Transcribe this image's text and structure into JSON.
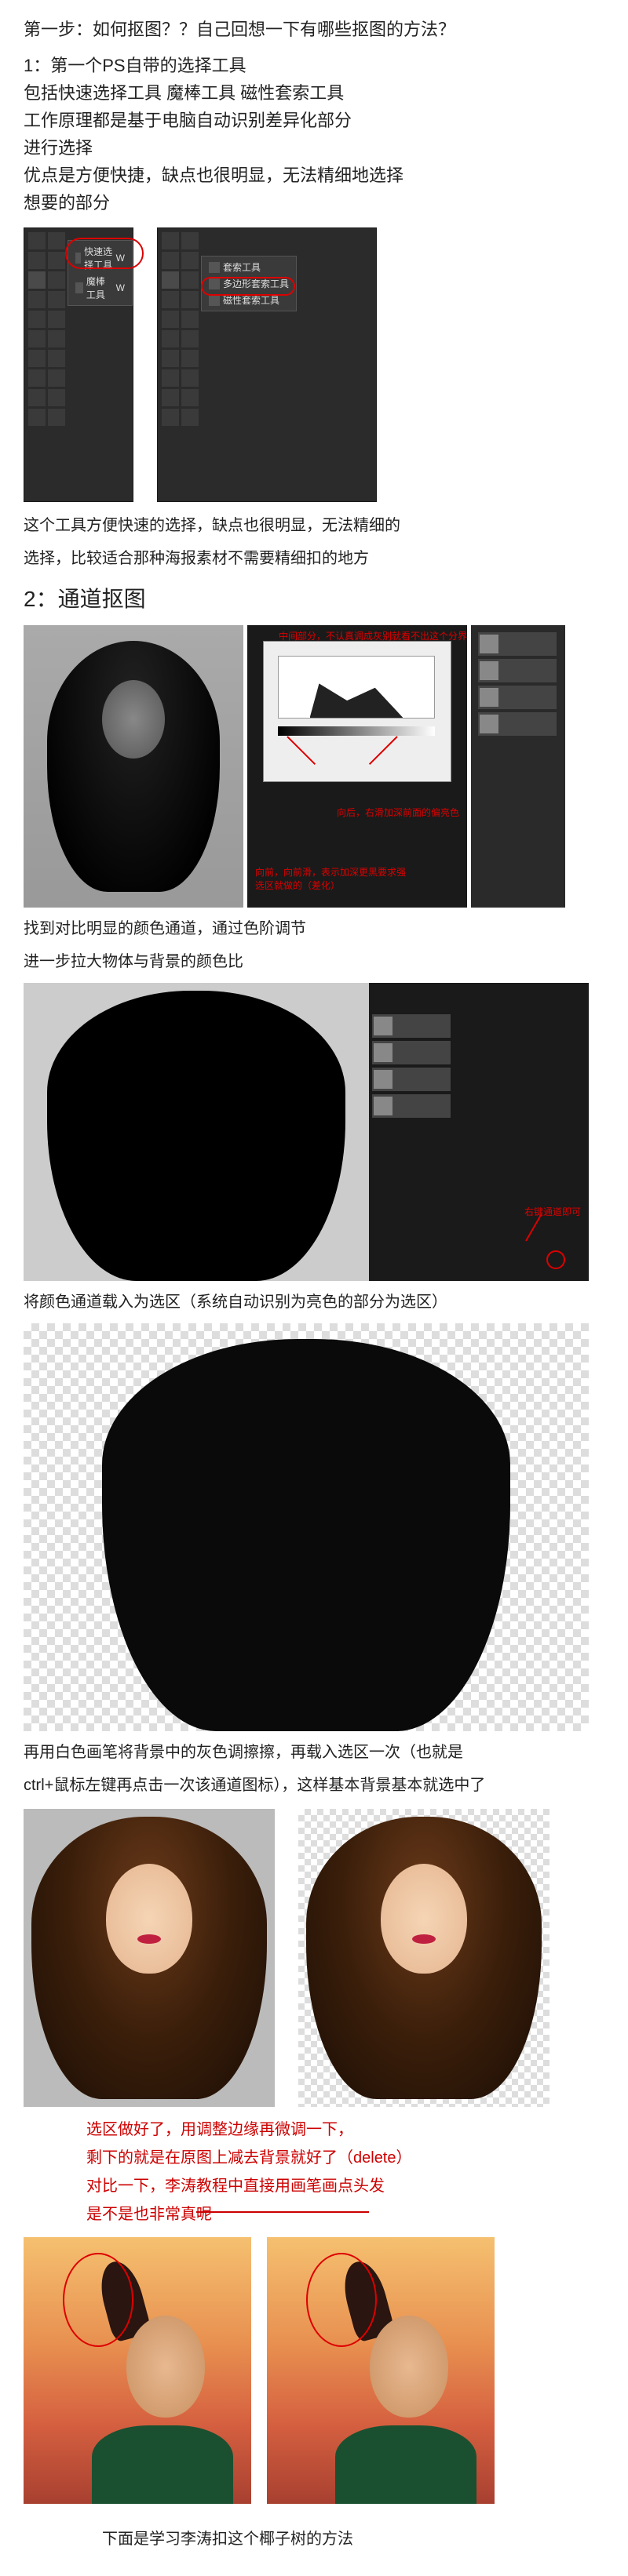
{
  "intro": {
    "step1_title": "第一步：如何抠图？？自己回想一下有哪些抠图的方法？",
    "method1_title": "1：第一个PS自带的选择工具",
    "method1_line1": "包括快速选择工具 魔棒工具 磁性套索工具",
    "method1_line2": "工作原理都是基于电脑自动识别差异化部分",
    "method1_line3": "进行选择",
    "method1_line4": "优点是方便快捷，缺点也很明显，无法精细地选择",
    "method1_line5": "想要的部分"
  },
  "toolbar1_flyout": {
    "item1": "快速选择工具",
    "item1_key": "W",
    "item2": "魔棒工具",
    "item2_key": "W"
  },
  "toolbar2_flyout": {
    "item1": "套索工具",
    "item2": "多边形套索工具",
    "item3": "磁性套索工具"
  },
  "summary1": {
    "line1": "这个工具方便快速的选择，缺点也很明显，无法精细的",
    "line2": "选择，比较适合那种海报素材不需要精细扣的地方"
  },
  "section2_title": "2：通道抠图",
  "levels_annotations": {
    "top_text": "中间部分，不认真调成灰别就看不出这个分界点",
    "bottom_right": "向后，右滑加深前面的偏亮色",
    "bottom_left": "向前，向前滑，表示加深更黑要求强选区就做的（差化）"
  },
  "caption1": {
    "line1": "找到对比明显的颜色通道，通过色阶调节",
    "line2": "进一步拉大物体与背景的颜色比"
  },
  "channel_annotation": "右键通道即可",
  "caption2": "将颜色通道载入为选区（系统自动识别为亮色的部分为选区）",
  "caption3": {
    "line1": "再用白色画笔将背景中的灰色调擦擦，再载入选区一次（也就是",
    "line2": "ctrl+鼠标左键再点击一次该通道图标），这样基本背景基本就选中了"
  },
  "final_captions": {
    "line1": "选区做好了，用调整边缘再微调一下，",
    "line2": "剩下的就是在原图上减去背景就好了（delete）",
    "compare1": "对比一下，李涛教程中直接用画笔画点头发",
    "compare2": "是不是也非常真呢"
  },
  "footer": "下面是学习李涛扣这个椰子树的方法"
}
